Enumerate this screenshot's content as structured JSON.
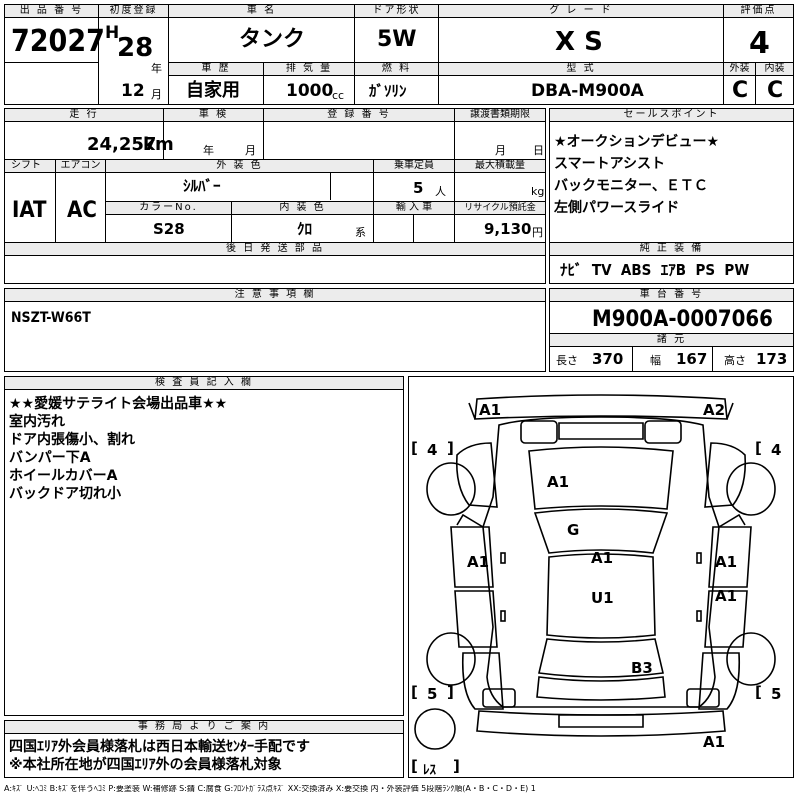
{
  "header": {
    "lot_number_label": "出 品 番 号",
    "lot_number": "72027",
    "first_reg_label": "初度登録",
    "era": "H",
    "year": "28",
    "year_unit": "年",
    "month": "12",
    "month_unit": "月",
    "car_name_label": "車 名",
    "car_name": "タンク",
    "door_label": "ドア形状",
    "door": "5W",
    "grade_label": "グ レ ー ド",
    "grade": "X S",
    "score_label": "評価点",
    "score": "4",
    "history_label": "車 歴",
    "history": "自家用",
    "displacement_label": "排 気 量",
    "displacement": "1000",
    "displacement_unit": "cc",
    "fuel_label": "燃 料",
    "fuel": "ｶﾞｿﾘﾝ",
    "model_label": "型 式",
    "model": "DBA-M900A",
    "exterior_label": "外装",
    "exterior": "C",
    "interior_label": "内装",
    "interior": "C"
  },
  "mid": {
    "mileage_label": "走 行",
    "mileage": "24,257",
    "mileage_unit": "km",
    "inspection_label": "車 検",
    "inspection_year_unit": "年",
    "inspection_month_unit": "月",
    "reg_number_label": "登 録 番 号",
    "transfer_label": "譲渡書類期限",
    "transfer_month_unit": "月",
    "transfer_day_unit": "日",
    "shift_label": "シフト",
    "shift": "IAT",
    "ac_label": "エアコン",
    "ac": "AC",
    "ext_color_label": "外 装 色",
    "ext_color": "ｼﾙﾊﾞｰ",
    "capacity_label": "乗車定員",
    "capacity": "5",
    "capacity_unit": "人",
    "max_load_label": "最大積載量",
    "max_load_unit": "kg",
    "color_no_label": "カラーNo.",
    "color_no": "S28",
    "int_color_label": "内 装 色",
    "int_color": "ｸﾛ",
    "int_color_unit": "系",
    "import_label": "輸 入 車",
    "recycle_label": "リサイクル預託金",
    "recycle": "9,130",
    "recycle_unit": "円",
    "later_parts_label": "後 日 発 送 部 品"
  },
  "sales": {
    "label": "セールスポイント",
    "points": [
      "★オークションデビュー★",
      "スマートアシスト",
      "バックモニター、ＥＴＣ",
      "左側パワースライド"
    ]
  },
  "equip": {
    "label": "純 正 装 備",
    "items": "ﾅﾋﾞ  TV  ABS  ｴｱB  PS  PW"
  },
  "notes": {
    "label": "注 意 事 項 欄",
    "text": "NSZT-W66T"
  },
  "chassis": {
    "label": "車 台 番 号",
    "number": "M900A-0007066",
    "spec_label": "諸 元",
    "length_label": "長さ",
    "length": "370",
    "width_label": "幅",
    "width": "167",
    "height_label": "高さ",
    "height": "173"
  },
  "inspector": {
    "label": "検 査 員 記 入 欄",
    "lines": [
      "★★愛媛サテライト会場出品車★★",
      "室内汚れ",
      "ドア内張傷小、割れ",
      "バンパー下A",
      "ホイールカバーA",
      "バックドア切れ小"
    ]
  },
  "office": {
    "label": "事 務 局 よ り ご 案 内",
    "lines": [
      "四国ｴﾘｱ外会員様落札は西日本輸送ｾﾝﾀｰ手配です",
      "※本社所在地が四国ｴﾘｱ外の会員様落札対象"
    ]
  },
  "diagram": {
    "marks": {
      "front_left": "A1",
      "front_right": "A2",
      "hood": "A1",
      "windshield": "G",
      "left_front_door": "A1",
      "roof": "A1",
      "right_front_door": "A1",
      "floor": "U1",
      "right_rear_door": "A1",
      "rear_glass": "B3",
      "rear_bumper": "A1"
    },
    "tires": {
      "fl": "4",
      "fr": "4",
      "rl": "5",
      "rr": "5",
      "spare": "ﾚｽ"
    },
    "bracket_open": "[",
    "bracket_close": "]"
  },
  "legend": "A:ｷｽﾞ U:ﾍｺﾐ B:ｷｽﾞを伴うﾍｺﾐ P:要塗装 W:補修跡 S:錆 C:腐食 G:ﾌﾛﾝﾄｶﾞﾗｽ点ｷｽﾞ XX:交換済み X:要交換 内・外装評価 5段階ﾗﾝｸ順(A・B・C・D・E) 1"
}
